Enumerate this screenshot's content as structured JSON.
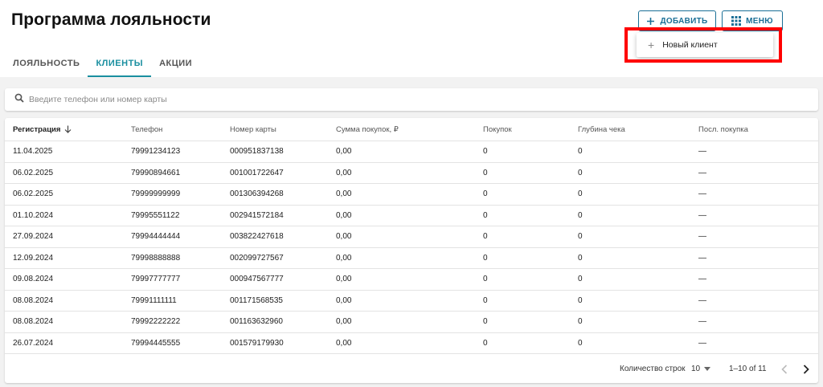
{
  "page_title": "Программа лояльности",
  "tabs": [
    {
      "label": "ЛОЯЛЬНОСТЬ",
      "active": false
    },
    {
      "label": "КЛИЕНТЫ",
      "active": true
    },
    {
      "label": "АКЦИИ",
      "active": false
    }
  ],
  "toolbar": {
    "add_label": "ДОБАВИТЬ",
    "add_icon": "plus-icon",
    "menu_label": "МЕНЮ",
    "menu_icon": "grid-icon"
  },
  "dropdown": {
    "items": [
      {
        "label": "Новый клиент",
        "icon": "plus-icon"
      }
    ]
  },
  "search": {
    "placeholder": "Введите телефон или номер карты",
    "value": "",
    "icon": "search-icon"
  },
  "table": {
    "columns": [
      "Регистрация",
      "Телефон",
      "Номер карты",
      "Сумма покупок, ₽",
      "Покупок",
      "Глубина чека",
      "Посл. покупка"
    ],
    "sort_column": "Регистрация",
    "sort_direction": "desc",
    "rows": [
      [
        "11.04.2025",
        "79991234123",
        "000951837138",
        "0,00",
        "0",
        "0",
        "—"
      ],
      [
        "06.02.2025",
        "79990894661",
        "001001722647",
        "0,00",
        "0",
        "0",
        "—"
      ],
      [
        "06.02.2025",
        "79999999999",
        "001306394268",
        "0,00",
        "0",
        "0",
        "—"
      ],
      [
        "01.10.2024",
        "79995551122",
        "002941572184",
        "0,00",
        "0",
        "0",
        "—"
      ],
      [
        "27.09.2024",
        "79994444444",
        "003822427618",
        "0,00",
        "0",
        "0",
        "—"
      ],
      [
        "12.09.2024",
        "79998888888",
        "002099727567",
        "0,00",
        "0",
        "0",
        "—"
      ],
      [
        "09.08.2024",
        "79997777777",
        "000947567777",
        "0,00",
        "0",
        "0",
        "—"
      ],
      [
        "08.08.2024",
        "79991111111",
        "001171568535",
        "0,00",
        "0",
        "0",
        "—"
      ],
      [
        "08.08.2024",
        "79992222222",
        "001163632960",
        "0,00",
        "0",
        "0",
        "—"
      ],
      [
        "26.07.2024",
        "79994445555",
        "001579179930",
        "0,00",
        "0",
        "0",
        "—"
      ]
    ]
  },
  "pagination": {
    "rows_label": "Количество строк",
    "rows_per_page": "10",
    "range": "1–10 of 11"
  },
  "colors": {
    "accent": "#1a8fa0",
    "button_border": "#1a6f96",
    "highlight": "#ff0000"
  }
}
